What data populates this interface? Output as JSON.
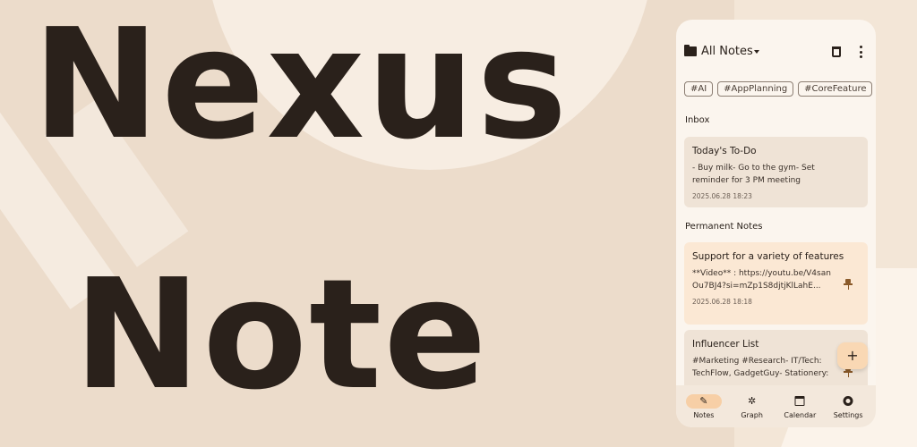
{
  "hero": {
    "line1": "Nexus",
    "line2": "Note"
  },
  "app": {
    "title": "All Notes",
    "tags": [
      "#AI",
      "#AppPlanning",
      "#CoreFeature"
    ],
    "sections": {
      "inbox": "Inbox",
      "permanent": "Permanent Notes"
    },
    "notes": [
      {
        "title": "Today's To-Do",
        "body": "- Buy milk- Go to the gym- Set reminder for 3 PM meeting",
        "date": "2025.06.28 18:23",
        "pinned": false
      },
      {
        "title": "Support for a variety of features",
        "body": "**Video** : https://youtu.be/V4sanOu7BJ4?si=mZp1S8djtjKlLahE...",
        "date": "2025.06.28 18:18",
        "pinned": true
      },
      {
        "title": "Influencer List",
        "body": "#Marketing #Research- IT/Tech: TechFlow, GadgetGuy- Stationery:",
        "pinned": true
      }
    ],
    "fab_label": "+",
    "nav": [
      {
        "label": "Notes",
        "icon": "pencil-icon",
        "active": true
      },
      {
        "label": "Graph",
        "icon": "graph-icon",
        "active": false
      },
      {
        "label": "Calendar",
        "icon": "calendar-icon",
        "active": false
      },
      {
        "label": "Settings",
        "icon": "gear-icon",
        "active": false
      }
    ]
  },
  "colors": {
    "background": "#ecdccb",
    "phone": "#fbf5ee",
    "accent": "#f7cfa6",
    "text": "#2a211b",
    "pin": "#8a5a2a"
  }
}
